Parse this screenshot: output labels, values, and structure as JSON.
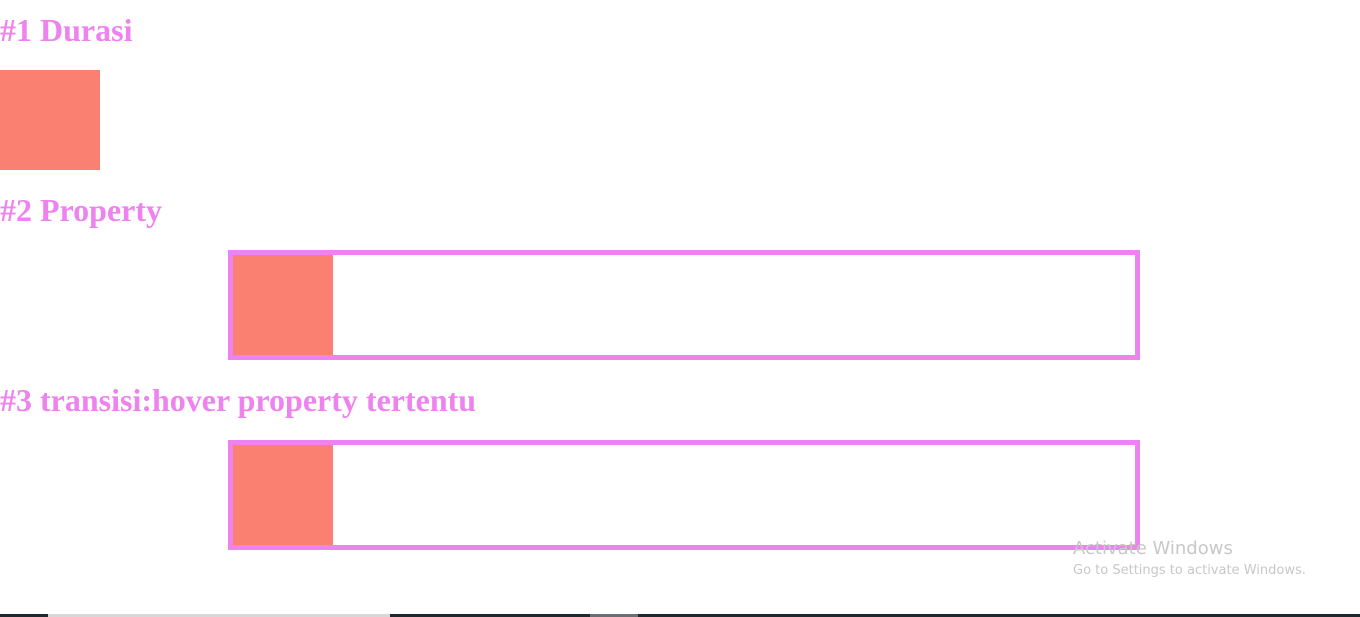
{
  "sections": {
    "durasi": {
      "title": "#1 Durasi"
    },
    "property": {
      "title": "#2 Property"
    },
    "hover": {
      "title": "#3 transisi:hover property tertentu"
    }
  },
  "colors": {
    "heading": "#ee82ee",
    "box": "#fa8072",
    "border": "#ee82ee",
    "background": "#ffffff"
  },
  "watermark": {
    "title": "Activate Windows",
    "subtitle": "Go to Settings to activate Windows."
  }
}
